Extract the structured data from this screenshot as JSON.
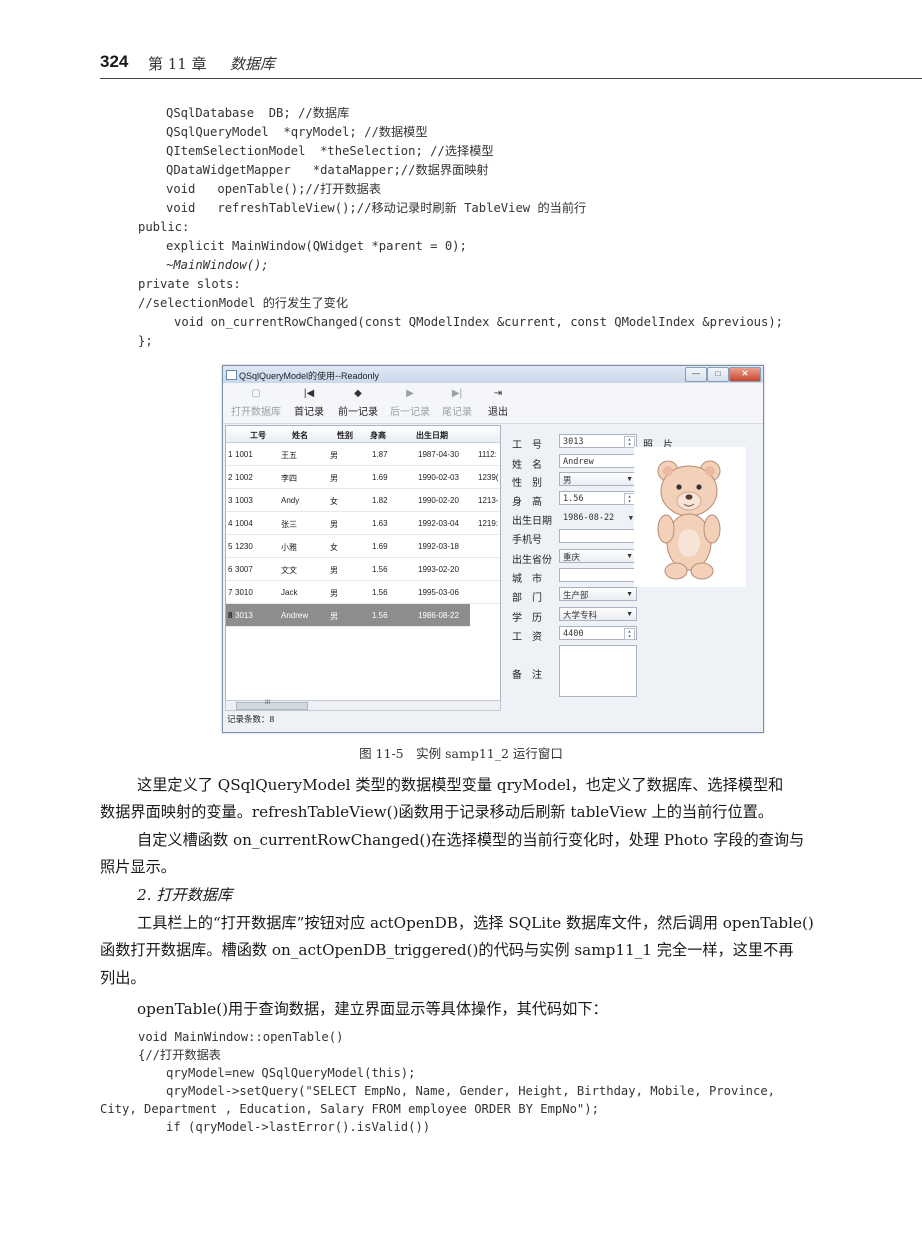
{
  "header": {
    "page_number": "324",
    "chapter": "第 11 章",
    "chapter_title": "数据库"
  },
  "code_top": [
    "QSqlDatabase  DB; //数据库",
    "QSqlQueryModel  *qryModel; //数据模型",
    "QItemSelectionModel  *theSelection; //选择模型",
    "QDataWidgetMapper   *dataMapper;//数据界面映射",
    "void   openTable();//打开数据表",
    "void   refreshTableView();//移动记录时刷新 TableView 的当前行",
    "public:",
    "explicit MainWindow(QWidget *parent = 0);",
    "~MainWindow();",
    "private slots:",
    "//selectionModel 的行发生了变化",
    "void on_currentRowChanged(const QModelIndex &current, const QModelIndex &previous);",
    "};"
  ],
  "window": {
    "title": "QSqlQueryModel的使用--Readonly",
    "min": "—",
    "max": "□",
    "close": "✕",
    "toolbar": [
      {
        "label": "打开数据库",
        "icon": "▢"
      },
      {
        "label": "首记录",
        "icon": "|◀"
      },
      {
        "label": "前一记录",
        "icon": "◆"
      },
      {
        "label": "后一记录",
        "icon": "▶"
      },
      {
        "label": "尾记录",
        "icon": "▶|"
      },
      {
        "label": "退出",
        "icon": "⇥"
      }
    ],
    "table": {
      "headers": [
        "工号",
        "姓名",
        "性别",
        "身高",
        "出生日期"
      ],
      "rows": [
        [
          "1",
          "1001",
          "王五",
          "男",
          "1.87",
          "1987-04-30",
          "1112:"
        ],
        [
          "2",
          "1002",
          "李四",
          "男",
          "1.69",
          "1990-02-03",
          "1239("
        ],
        [
          "3",
          "1003",
          "Andy",
          "女",
          "1.82",
          "1990-02-20",
          "1213-"
        ],
        [
          "4",
          "1004",
          "张三",
          "男",
          "1.63",
          "1992-03-04",
          "1219:"
        ],
        [
          "5",
          "1230",
          "小雅",
          "女",
          "1.69",
          "1992-03-18",
          ""
        ],
        [
          "6",
          "3007",
          "文文",
          "男",
          "1.56",
          "1993-02-20",
          ""
        ],
        [
          "7",
          "3010",
          "Jack",
          "男",
          "1.56",
          "1995-03-06",
          ""
        ],
        [
          "8",
          "3013",
          "Andrew",
          "男",
          "1.56",
          "1986-08-22",
          ""
        ]
      ],
      "scroll_mark": "III"
    },
    "status": "记录条数：8",
    "form": {
      "labels": {
        "empno": "工　号",
        "name": "姓　名",
        "gender": "性　别",
        "height": "身　高",
        "birthday": "出生日期",
        "mobile": "手机号",
        "province": "出生省份",
        "city": "城　市",
        "dept": "部　门",
        "edu": "学　历",
        "salary": "工　资",
        "memo": "备　注",
        "photo": "照　片"
      },
      "values": {
        "empno": "3013",
        "name": "Andrew",
        "gender": "男",
        "height": "1.56",
        "birthday": "1986-08-22",
        "province": "重庆",
        "dept": "生产部",
        "edu": "大学专科",
        "salary": "4400"
      }
    }
  },
  "caption": "图 11-5　实例 samp11_2 运行窗口",
  "paragraphs": [
    "这里定义了 QSqlQueryModel 类型的数据模型变量 qryModel，也定义了数据库、选择模型和",
    "数据界面映射的变量。refreshTableView()函数用于记录移动后刷新 tableView 上的当前行位置。",
    "自定义槽函数 on_currentRowChanged()在选择模型的当前行变化时，处理 Photo 字段的查询与",
    "照片显示。",
    "2.  打开数据库",
    "工具栏上的“打开数据库”按钮对应 actOpenDB，选择 SQLite 数据库文件，然后调用 openTable()",
    "函数打开数据库。槽函数 on_actOpenDB_triggered()的代码与实例 samp11_1 完全一样，这里不再",
    "列出。",
    "openTable()用于查询数据，建立界面显示等具体操作，其代码如下："
  ],
  "code_bottom": [
    "void MainWindow::openTable()",
    "{//打开数据表",
    "qryModel=new QSqlQueryModel(this);",
    "qryModel->setQuery(\"SELECT EmpNo, Name, Gender, Height, Birthday, Mobile, Province,",
    "City, Department , Education, Salary FROM employee ORDER BY EmpNo\");",
    "if (qryModel->lastError().isValid())"
  ]
}
